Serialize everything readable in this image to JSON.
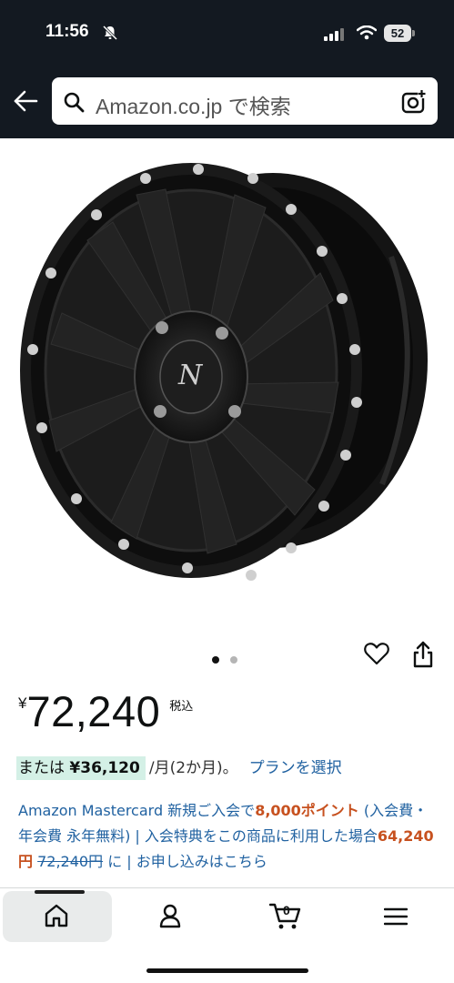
{
  "status_bar": {
    "time": "11:56",
    "battery": "52"
  },
  "search": {
    "placeholder": "Amazon.co.jp で検索"
  },
  "carousel": {
    "active_index": 0,
    "total": 2
  },
  "price": {
    "symbol": "¥",
    "value": "72,240",
    "tax_label": "税込"
  },
  "installment": {
    "prefix": "または",
    "amount": "¥36,120",
    "period": "/月(2か月)。",
    "plan_link": "プランを選択"
  },
  "promo": {
    "line_part1": "Amazon Mastercard 新規ご入会で",
    "points": "8,000ポイント",
    "line_part2": " (入会費・年会費 永年無料) | 入会特典をこの商品に利用した場合",
    "discounted_price": "64,240円",
    "original_price": "72,240円",
    "line_part3": " に | お申し込みはこちら"
  },
  "bottom_nav": {
    "items": [
      "home",
      "account",
      "cart",
      "menu"
    ],
    "cart_count": "0"
  },
  "colors": {
    "header_bg": "#131921",
    "link": "#2162a1",
    "highlight": "#d4f0e6",
    "promo_accent": "#c7511f"
  }
}
